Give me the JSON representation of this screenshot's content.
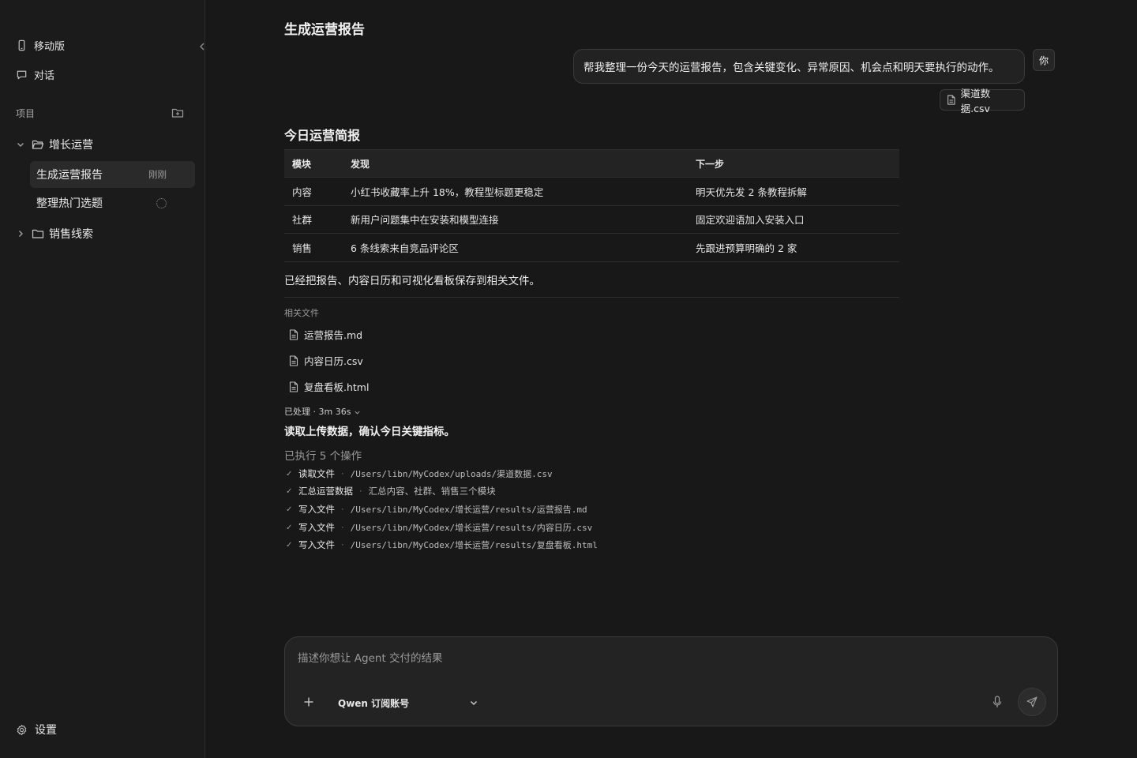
{
  "sidebar": {
    "mobile_label": "移动版",
    "chat_label": "对话",
    "projects_label": "项目",
    "projects": [
      {
        "name": "增长运营",
        "expanded": true,
        "tasks": [
          {
            "name": "生成运营报告",
            "meta": "刚刚",
            "active": true
          },
          {
            "name": "整理热门选题",
            "meta": "",
            "loading": true
          }
        ]
      },
      {
        "name": "销售线索",
        "expanded": false
      }
    ],
    "settings_label": "设置"
  },
  "main": {
    "title": "生成运营报告",
    "user_message": "帮我整理一份今天的运营报告，包含关键变化、异常原因、机会点和明天要执行的动作。",
    "user_avatar": "你",
    "attachment": "渠道数据.csv",
    "report": {
      "title": "今日运营简报",
      "headers": [
        "模块",
        "发现",
        "下一步"
      ],
      "rows": [
        [
          "内容",
          "小红书收藏率上升 18%，教程型标题更稳定",
          "明天优先发 2 条教程拆解"
        ],
        [
          "社群",
          "新用户问题集中在安装和模型连接",
          "固定欢迎语加入安装入口"
        ],
        [
          "销售",
          "6 条线索来自竞品评论区",
          "先跟进预算明确的 2 家"
        ]
      ]
    },
    "saved_note": "已经把报告、内容日历和可视化看板保存到相关文件。",
    "files_label": "相关文件",
    "files": [
      "运营报告.md",
      "内容日历.csv",
      "复盘看板.html"
    ],
    "processed": "已处理 · 3m 36s",
    "step": "读取上传数据，确认今日关键指标。",
    "ops_title": "已执行 5 个操作",
    "ops": [
      {
        "label": "读取文件",
        "detail": "/Users/libn/MyCodex/uploads/渠道数据.csv",
        "is_path": true
      },
      {
        "label": "汇总运营数据",
        "detail": "汇总内容、社群、销售三个模块",
        "is_path": false
      },
      {
        "label": "写入文件",
        "detail": "/Users/libn/MyCodex/增长运营/results/运营报告.md",
        "is_path": true
      },
      {
        "label": "写入文件",
        "detail": "/Users/libn/MyCodex/增长运营/results/内容日历.csv",
        "is_path": true
      },
      {
        "label": "写入文件",
        "detail": "/Users/libn/MyCodex/增长运营/results/复盘看板.html",
        "is_path": true
      }
    ]
  },
  "composer": {
    "placeholder": "描述你想让 Agent 交付的结果",
    "value": "",
    "model": "Qwen 订阅账号"
  },
  "colors": {
    "background": "#181818",
    "sidebar": "#1b1b1b",
    "active_item": "#2a2a2a",
    "border": "#3a3a3a",
    "text": "#e8e8e8",
    "muted": "#9a9a9a"
  }
}
